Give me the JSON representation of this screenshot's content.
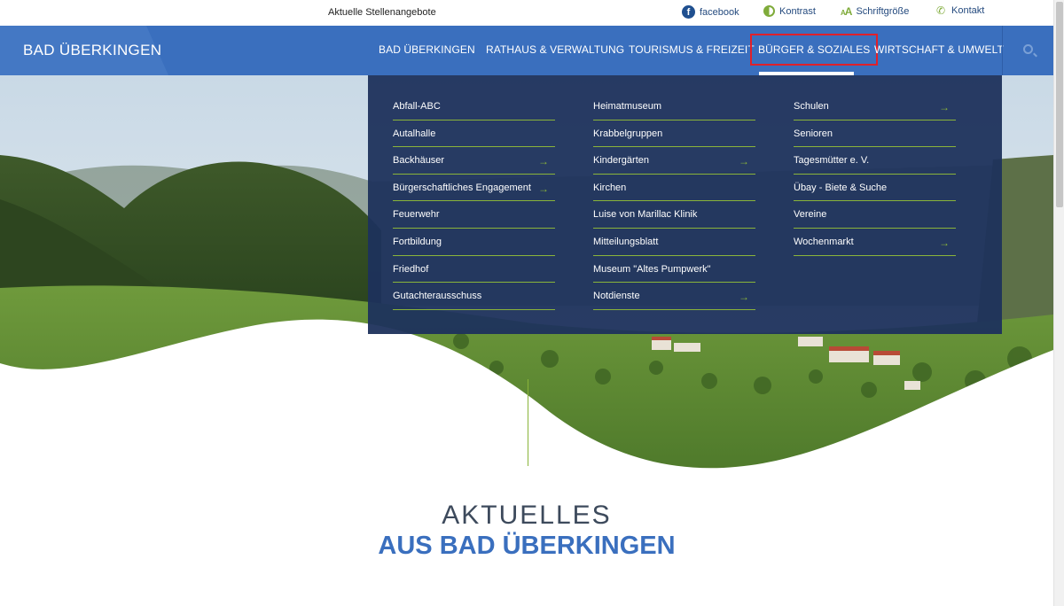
{
  "topbar": {
    "jobs_link": "Aktuelle Stellenangebote",
    "facebook": "facebook",
    "contrast": "Kontrast",
    "fontsize": "Schriftgröße",
    "contact": "Kontakt"
  },
  "header": {
    "logo": "BAD ÜBERKINGEN",
    "nav": [
      {
        "label": "BAD ÜBERKINGEN"
      },
      {
        "label": "RATHAUS & VERWALTUNG"
      },
      {
        "label": "TOURISMUS & FREIZEIT"
      },
      {
        "label": "BÜRGER & SOZIALES",
        "active": true
      },
      {
        "label": "WIRTSCHAFT & UMWELT"
      }
    ]
  },
  "mega_menu": {
    "col1": [
      {
        "label": "Abfall-ABC"
      },
      {
        "label": "Autalhalle"
      },
      {
        "label": "Backhäuser",
        "has_sub": true
      },
      {
        "label": "Bürgerschaftliches Engagement",
        "has_sub": true
      },
      {
        "label": "Feuerwehr"
      },
      {
        "label": "Fortbildung"
      },
      {
        "label": "Friedhof"
      },
      {
        "label": "Gutachterausschuss"
      }
    ],
    "col2": [
      {
        "label": "Heimatmuseum"
      },
      {
        "label": "Krabbelgruppen"
      },
      {
        "label": "Kindergärten",
        "has_sub": true
      },
      {
        "label": "Kirchen"
      },
      {
        "label": "Luise von Marillac Klinik"
      },
      {
        "label": "Mitteilungsblatt"
      },
      {
        "label": "Museum \"Altes Pumpwerk\""
      },
      {
        "label": "Notdienste",
        "has_sub": true
      }
    ],
    "col3": [
      {
        "label": "Schulen",
        "has_sub": true
      },
      {
        "label": "Senioren"
      },
      {
        "label": "Tagesmütter e. V."
      },
      {
        "label": "Übay - Biete & Suche"
      },
      {
        "label": "Vereine"
      },
      {
        "label": "Wochenmarkt",
        "has_sub": true
      }
    ],
    "arrow_glyph": "→"
  },
  "news": {
    "line1": "AKTUELLES",
    "line2": "AUS BAD ÜBERKINGEN"
  },
  "colors": {
    "brand_blue": "#3a6fbe",
    "menu_bg": "#1d325c",
    "accent_green": "#8ab43a",
    "highlight_red": "#e0202a"
  }
}
